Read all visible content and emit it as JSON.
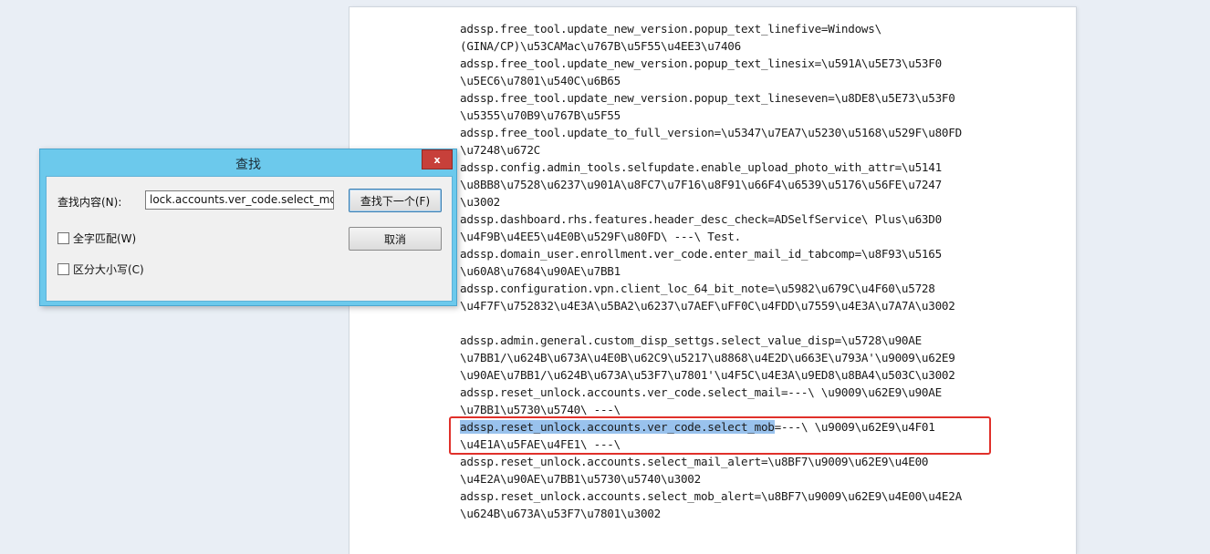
{
  "document": {
    "lines": [
      "adssp.free_tool.update_new_version.popup_text_linefive=Windows\\",
      "(GINA/CP)\\u53CAMac\\u767B\\u5F55\\u4EE3\\u7406",
      "adssp.free_tool.update_new_version.popup_text_linesix=\\u591A\\u5E73\\u53F0",
      "\\u5EC6\\u7801\\u540C\\u6B65",
      "adssp.free_tool.update_new_version.popup_text_lineseven=\\u8DE8\\u5E73\\u53F0",
      "\\u5355\\u70B9\\u767B\\u5F55",
      "adssp.free_tool.update_to_full_version=\\u5347\\u7EA7\\u5230\\u5168\\u529F\\u80FD",
      "\\u7248\\u672C",
      "adssp.config.admin_tools.selfupdate.enable_upload_photo_with_attr=\\u5141",
      "\\u8BB8\\u7528\\u6237\\u901A\\u8FC7\\u7F16\\u8F91\\u66F4\\u6539\\u5176\\u56FE\\u7247",
      "\\u3002",
      "adssp.dashboard.rhs.features.header_desc_check=ADSelfService\\ Plus\\u63D0",
      "\\u4F9B\\u4EE5\\u4E0B\\u529F\\u80FD\\ ---\\ Test.",
      "adssp.domain_user.enrollment.ver_code.enter_mail_id_tabcomp=\\u8F93\\u5165",
      "\\u60A8\\u7684\\u90AE\\u7BB1",
      "adssp.configuration.vpn.client_loc_64_bit_note=\\u5982\\u679C\\u4F60\\u5728",
      "\\u4F7F\\u752832\\u4E3A\\u5BA2\\u6237\\u7AEF\\uFF0C\\u4FDD\\u7559\\u4E3A\\u7A7A\\u3002",
      "",
      "adssp.admin.general.custom_disp_settgs.select_value_disp=\\u5728\\u90AE",
      "\\u7BB1/\\u624B\\u673A\\u4E0B\\u62C9\\u5217\\u8868\\u4E2D\\u663E\\u793A'\\u9009\\u62E9",
      "\\u90AE\\u7BB1/\\u624B\\u673A\\u53F7\\u7801'\\u4F5C\\u4E3A\\u9ED8\\u8BA4\\u503C\\u3002",
      "adssp.reset_unlock.accounts.ver_code.select_mail=---\\ \\u9009\\u62E9\\u90AE",
      "\\u7BB1\\u5730\\u5740\\ ---\\",
      "",
      "\\u4E1A\\u5FAE\\u4FE1\\ ---\\",
      "adssp.reset_unlock.accounts.select_mail_alert=\\u8BF7\\u9009\\u62E9\\u4E00",
      "\\u4E2A\\u90AE\\u7BB1\\u5730\\u5740\\u3002",
      "adssp.reset_unlock.accounts.select_mob_alert=\\u8BF7\\u9009\\u62E9\\u4E00\\u4E2A",
      "\\u624B\\u673A\\u53F7\\u7801\\u3002"
    ],
    "match_line_highlight": "adssp.reset_unlock.accounts.ver_code.select_mob",
    "match_line_rest": "=---\\ \\u9009\\u62E9\\u4F01"
  },
  "find_dialog": {
    "title": "查找",
    "close_label": "x",
    "find_label": "查找内容(N):",
    "find_value": "lock.accounts.ver_code.select_mob",
    "find_next_label": "查找下一个(F)",
    "cancel_label": "取消",
    "match_whole_word_label": "全字匹配(W)",
    "match_case_label": "区分大小写(C)"
  },
  "colors": {
    "highlight": "#99c2ed",
    "annotation_box": "#e0302a",
    "dialog_frame": "#6cc9ec"
  }
}
